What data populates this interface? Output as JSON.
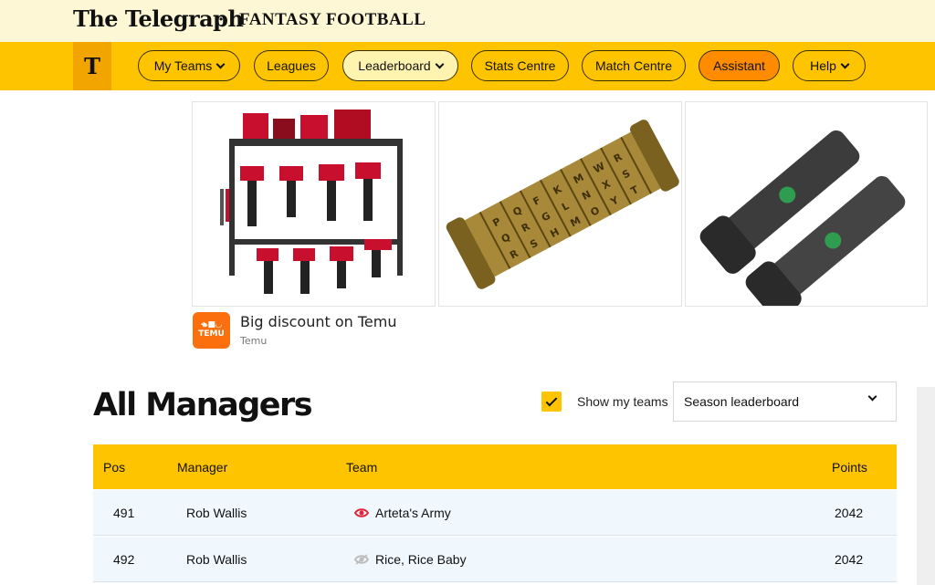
{
  "masthead": {
    "brand": "The Telegraph",
    "separator": "•",
    "product": "FANTASY FOOTBALL"
  },
  "nav": {
    "logo": "T",
    "items": [
      {
        "label": "My Teams",
        "has_dropdown": true
      },
      {
        "label": "Leagues",
        "has_dropdown": false
      },
      {
        "label": "Leaderboard",
        "has_dropdown": true,
        "active": true
      },
      {
        "label": "Stats Centre",
        "has_dropdown": false
      },
      {
        "label": "Match Centre",
        "has_dropdown": false
      },
      {
        "label": "Assistant",
        "has_dropdown": false,
        "highlight": true
      },
      {
        "label": "Help",
        "has_dropdown": true
      }
    ]
  },
  "ad": {
    "images": [
      "tool-rack-image",
      "cryptex-lock-image",
      "flashlights-image"
    ],
    "logo_text_top": "ቈ■◡",
    "logo_text_bottom": "TEMU",
    "headline": "Big discount on Temu",
    "source": "Temu"
  },
  "leaderboard": {
    "title": "All Managers",
    "show_my_teams_label": "Show my teams",
    "show_my_teams_checked": true,
    "select_value": "Season leaderboard",
    "columns": {
      "pos": "Pos",
      "manager": "Manager",
      "team": "Team",
      "points": "Points"
    },
    "rows": [
      {
        "pos": "491",
        "manager": "Rob Wallis",
        "team": "Arteta's Army",
        "points": "2042",
        "eye_color": "#e0243c"
      },
      {
        "pos": "492",
        "manager": "Rob Wallis",
        "team": "Rice, Rice Baby",
        "points": "2042",
        "eye_color": "#bdbdbd"
      }
    ]
  },
  "colors": {
    "accent": "#ffc400",
    "masthead_bg": "#fdf7d6",
    "assistant": "#ff8c00",
    "row_bg": "#f0f8fd",
    "temu": "#fb6f0f"
  }
}
